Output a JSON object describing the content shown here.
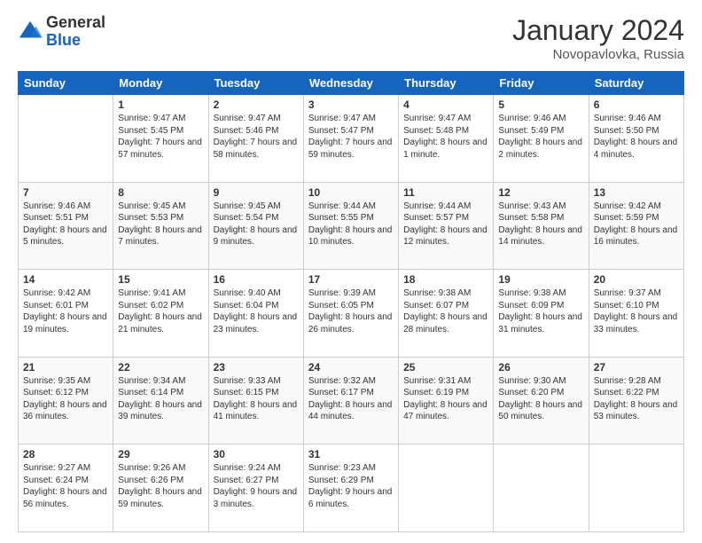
{
  "header": {
    "logo_general": "General",
    "logo_blue": "Blue",
    "title": "January 2024",
    "location": "Novopavlovka, Russia"
  },
  "days_of_week": [
    "Sunday",
    "Monday",
    "Tuesday",
    "Wednesday",
    "Thursday",
    "Friday",
    "Saturday"
  ],
  "weeks": [
    [
      {
        "day": "",
        "content": ""
      },
      {
        "day": "1",
        "content": "Sunrise: 9:47 AM\nSunset: 5:45 PM\nDaylight: 7 hours\nand 57 minutes."
      },
      {
        "day": "2",
        "content": "Sunrise: 9:47 AM\nSunset: 5:46 PM\nDaylight: 7 hours\nand 58 minutes."
      },
      {
        "day": "3",
        "content": "Sunrise: 9:47 AM\nSunset: 5:47 PM\nDaylight: 7 hours\nand 59 minutes."
      },
      {
        "day": "4",
        "content": "Sunrise: 9:47 AM\nSunset: 5:48 PM\nDaylight: 8 hours\nand 1 minute."
      },
      {
        "day": "5",
        "content": "Sunrise: 9:46 AM\nSunset: 5:49 PM\nDaylight: 8 hours\nand 2 minutes."
      },
      {
        "day": "6",
        "content": "Sunrise: 9:46 AM\nSunset: 5:50 PM\nDaylight: 8 hours\nand 4 minutes."
      }
    ],
    [
      {
        "day": "7",
        "content": "Sunrise: 9:46 AM\nSunset: 5:51 PM\nDaylight: 8 hours\nand 5 minutes."
      },
      {
        "day": "8",
        "content": "Sunrise: 9:45 AM\nSunset: 5:53 PM\nDaylight: 8 hours\nand 7 minutes."
      },
      {
        "day": "9",
        "content": "Sunrise: 9:45 AM\nSunset: 5:54 PM\nDaylight: 8 hours\nand 9 minutes."
      },
      {
        "day": "10",
        "content": "Sunrise: 9:44 AM\nSunset: 5:55 PM\nDaylight: 8 hours\nand 10 minutes."
      },
      {
        "day": "11",
        "content": "Sunrise: 9:44 AM\nSunset: 5:57 PM\nDaylight: 8 hours\nand 12 minutes."
      },
      {
        "day": "12",
        "content": "Sunrise: 9:43 AM\nSunset: 5:58 PM\nDaylight: 8 hours\nand 14 minutes."
      },
      {
        "day": "13",
        "content": "Sunrise: 9:42 AM\nSunset: 5:59 PM\nDaylight: 8 hours\nand 16 minutes."
      }
    ],
    [
      {
        "day": "14",
        "content": "Sunrise: 9:42 AM\nSunset: 6:01 PM\nDaylight: 8 hours\nand 19 minutes."
      },
      {
        "day": "15",
        "content": "Sunrise: 9:41 AM\nSunset: 6:02 PM\nDaylight: 8 hours\nand 21 minutes."
      },
      {
        "day": "16",
        "content": "Sunrise: 9:40 AM\nSunset: 6:04 PM\nDaylight: 8 hours\nand 23 minutes."
      },
      {
        "day": "17",
        "content": "Sunrise: 9:39 AM\nSunset: 6:05 PM\nDaylight: 8 hours\nand 26 minutes."
      },
      {
        "day": "18",
        "content": "Sunrise: 9:38 AM\nSunset: 6:07 PM\nDaylight: 8 hours\nand 28 minutes."
      },
      {
        "day": "19",
        "content": "Sunrise: 9:38 AM\nSunset: 6:09 PM\nDaylight: 8 hours\nand 31 minutes."
      },
      {
        "day": "20",
        "content": "Sunrise: 9:37 AM\nSunset: 6:10 PM\nDaylight: 8 hours\nand 33 minutes."
      }
    ],
    [
      {
        "day": "21",
        "content": "Sunrise: 9:35 AM\nSunset: 6:12 PM\nDaylight: 8 hours\nand 36 minutes."
      },
      {
        "day": "22",
        "content": "Sunrise: 9:34 AM\nSunset: 6:14 PM\nDaylight: 8 hours\nand 39 minutes."
      },
      {
        "day": "23",
        "content": "Sunrise: 9:33 AM\nSunset: 6:15 PM\nDaylight: 8 hours\nand 41 minutes."
      },
      {
        "day": "24",
        "content": "Sunrise: 9:32 AM\nSunset: 6:17 PM\nDaylight: 8 hours\nand 44 minutes."
      },
      {
        "day": "25",
        "content": "Sunrise: 9:31 AM\nSunset: 6:19 PM\nDaylight: 8 hours\nand 47 minutes."
      },
      {
        "day": "26",
        "content": "Sunrise: 9:30 AM\nSunset: 6:20 PM\nDaylight: 8 hours\nand 50 minutes."
      },
      {
        "day": "27",
        "content": "Sunrise: 9:28 AM\nSunset: 6:22 PM\nDaylight: 8 hours\nand 53 minutes."
      }
    ],
    [
      {
        "day": "28",
        "content": "Sunrise: 9:27 AM\nSunset: 6:24 PM\nDaylight: 8 hours\nand 56 minutes."
      },
      {
        "day": "29",
        "content": "Sunrise: 9:26 AM\nSunset: 6:26 PM\nDaylight: 8 hours\nand 59 minutes."
      },
      {
        "day": "30",
        "content": "Sunrise: 9:24 AM\nSunset: 6:27 PM\nDaylight: 9 hours\nand 3 minutes."
      },
      {
        "day": "31",
        "content": "Sunrise: 9:23 AM\nSunset: 6:29 PM\nDaylight: 9 hours\nand 6 minutes."
      },
      {
        "day": "",
        "content": ""
      },
      {
        "day": "",
        "content": ""
      },
      {
        "day": "",
        "content": ""
      }
    ]
  ]
}
